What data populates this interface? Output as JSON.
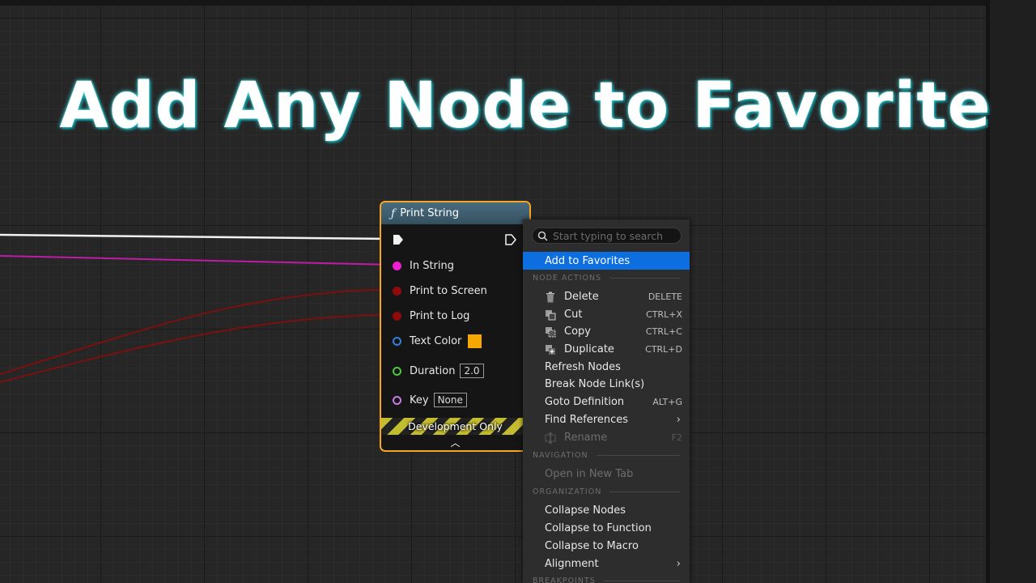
{
  "overlay_title": "Add Any Node to Favorite",
  "node": {
    "title": "Print String",
    "function_icon": "function-icon",
    "pins": {
      "in_string": "In String",
      "print_to_screen": "Print to Screen",
      "print_to_log": "Print to Log",
      "text_color": "Text Color",
      "duration": "Duration",
      "duration_value": "2.0",
      "key": "Key",
      "key_value": "None"
    },
    "text_color_swatch": "#f5a800",
    "dev_band": "Development Only",
    "border_color": "#f5a623"
  },
  "context_menu": {
    "search_placeholder": "Start typing to search",
    "highlighted_item": "Add to Favorites",
    "sections": {
      "node_actions": "NODE ACTIONS",
      "navigation": "NAVIGATION",
      "organization": "ORGANIZATION",
      "breakpoints": "BREAKPOINTS"
    },
    "items": {
      "delete": {
        "label": "Delete",
        "shortcut": "DELETE"
      },
      "cut": {
        "label": "Cut",
        "shortcut": "CTRL+X"
      },
      "copy": {
        "label": "Copy",
        "shortcut": "CTRL+C"
      },
      "duplicate": {
        "label": "Duplicate",
        "shortcut": "CTRL+D"
      },
      "refresh_nodes": {
        "label": "Refresh Nodes"
      },
      "break_links": {
        "label": "Break Node Link(s)"
      },
      "goto_definition": {
        "label": "Goto Definition",
        "shortcut": "ALT+G"
      },
      "find_references": {
        "label": "Find References"
      },
      "rename": {
        "label": "Rename",
        "shortcut": "F2"
      },
      "open_new_tab": {
        "label": "Open in New Tab"
      },
      "collapse_nodes": {
        "label": "Collapse Nodes"
      },
      "collapse_function": {
        "label": "Collapse to Function"
      },
      "collapse_macro": {
        "label": "Collapse to Macro"
      },
      "alignment": {
        "label": "Alignment"
      }
    },
    "highlight_color": "#0d6ee0"
  }
}
